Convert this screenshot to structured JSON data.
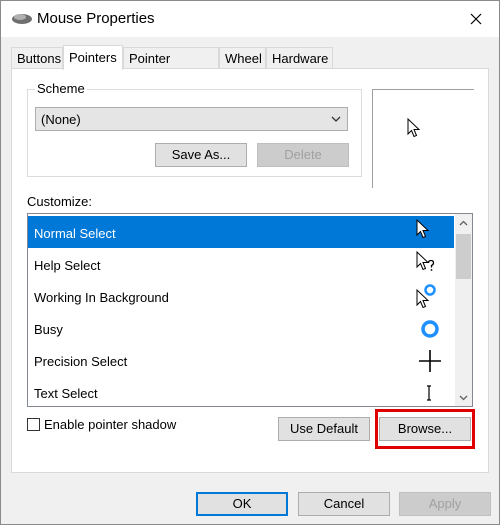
{
  "window": {
    "title": "Mouse Properties"
  },
  "tabs": [
    {
      "label": "Buttons",
      "active": false
    },
    {
      "label": "Pointers",
      "active": true
    },
    {
      "label": "Pointer Options",
      "active": false
    },
    {
      "label": "Wheel",
      "active": false
    },
    {
      "label": "Hardware",
      "active": false
    }
  ],
  "scheme": {
    "label": "Scheme",
    "selected": "(None)",
    "save_as": "Save As...",
    "delete": "Delete"
  },
  "customize": {
    "label": "Customize:",
    "items": [
      {
        "label": "Normal Select",
        "icon": "arrow-cursor-icon",
        "selected": true
      },
      {
        "label": "Help Select",
        "icon": "help-cursor-icon",
        "selected": false
      },
      {
        "label": "Working In Background",
        "icon": "working-cursor-icon",
        "selected": false
      },
      {
        "label": "Busy",
        "icon": "busy-cursor-icon",
        "selected": false
      },
      {
        "label": "Precision Select",
        "icon": "crosshair-cursor-icon",
        "selected": false
      },
      {
        "label": "Text Select",
        "icon": "ibeam-cursor-icon",
        "selected": false
      }
    ]
  },
  "shadow": {
    "label": "Enable pointer shadow",
    "checked": false
  },
  "buttons": {
    "use_default": "Use Default",
    "browse": "Browse...",
    "ok": "OK",
    "cancel": "Cancel",
    "apply": "Apply"
  },
  "colors": {
    "accent": "#0078d7",
    "highlight": "#e00000",
    "busy_ring": "#1e90ff"
  }
}
